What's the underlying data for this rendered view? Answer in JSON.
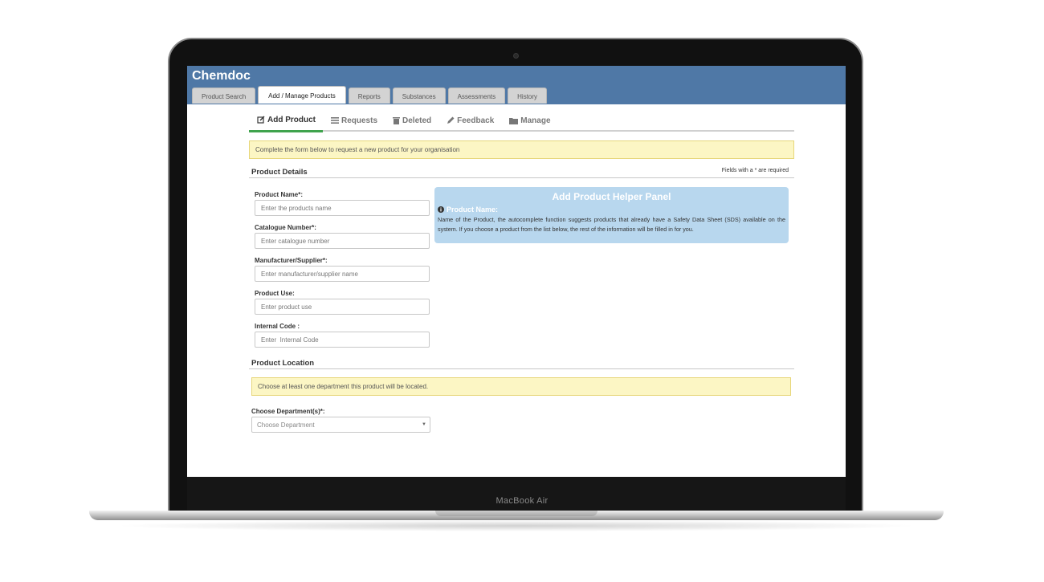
{
  "laptop": {
    "brand_label": "MacBook Air"
  },
  "app": {
    "title": "Chemdoc",
    "tabs": [
      {
        "label": "Product Search"
      },
      {
        "label": "Add / Manage Products",
        "active": true
      },
      {
        "label": "Reports"
      },
      {
        "label": "Substances"
      },
      {
        "label": "Assessments"
      },
      {
        "label": "History"
      }
    ]
  },
  "subnav": {
    "items": [
      {
        "label": "Add Product",
        "icon": "edit-icon",
        "active": true
      },
      {
        "label": "Requests",
        "icon": "list-icon"
      },
      {
        "label": "Deleted",
        "icon": "trash-icon"
      },
      {
        "label": "Feedback",
        "icon": "pencil-icon"
      },
      {
        "label": "Manage",
        "icon": "folder-icon"
      }
    ]
  },
  "notice_top": "Complete the form below to request a new product for your organisation",
  "product_details": {
    "title": "Product Details",
    "required_note": "Fields with a * are required",
    "fields": [
      {
        "label": "Product Name*:",
        "placeholder": "Enter the products name"
      },
      {
        "label": "Catalogue Number*:",
        "placeholder": "Enter catalogue number"
      },
      {
        "label": "Manufacturer/Supplier*:",
        "placeholder": "Enter manufacturer/supplier name"
      },
      {
        "label": "Product Use:",
        "placeholder": "Enter product use"
      },
      {
        "label": "Internal Code :",
        "placeholder": "Enter  Internal Code"
      }
    ]
  },
  "helper_panel": {
    "title": "Add Product Helper Panel",
    "subtitle": "Product Name:",
    "text": "Name of the Product, the autocomplete function suggests products that already have a Safety Data Sheet (SDS) available on the system. If you choose a product from the list below, the rest of the information will be filled in for you."
  },
  "product_location": {
    "title": "Product Location",
    "notice": "Choose at least one department this product will be located.",
    "department_label": "Choose Department(s)*:",
    "department_placeholder": "Choose Department"
  },
  "colors": {
    "header": "#4f78a6",
    "active_underline": "#3fa34d",
    "notice_bg": "#fcf6c4",
    "helper_bg": "#b8d7ee"
  }
}
